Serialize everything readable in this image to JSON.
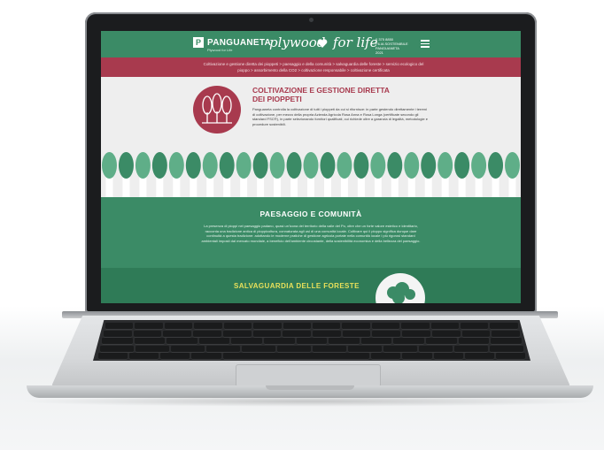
{
  "site": {
    "brand": "PANGUANETA",
    "brand_tagline": "Plywood for Life",
    "script_title_part1": "plywood",
    "script_title_part2": "for life",
    "contact_lines": [
      "0 375 8850",
      "FILIA SOSTENIBILE",
      "PANGUANETA",
      "2021"
    ],
    "breadcrumbs": "Coltivazione e gestione diretta dei pioppeti > paesaggio e della comunità > salvaguardia delle foreste > servizio ecologico del pioppo > assorbimento della CO2 > coltivazione responsabile > coltivazione certificata",
    "intro": {
      "title_line1": "COLTIVAZIONE E GESTIONE DIRETTA",
      "title_line2": "DEI PIOPPETI",
      "body": "Panguaneta controlla la coltivazione di tutti i pioppeti da cui si rifornisce: in parte gestendo direttamente i terreni di coltivazione, per mezzo della propria Azienda Agricola Rosa Anna e Rosa Longa (certificate secondo gli standard FSC®), in parte selezionando fornitori qualificati, cui richiede oltre a garanzia di legalità, metodologie e procedure sostenibili."
    },
    "section2": {
      "title": "PAESAGGIO E COMUNITÀ",
      "body": "La presenza di pioppi nel paesaggio padano, quasi un'icona del territorio della valle del Po, oltre che un forte valore estetico e identitario, racconta una tradizione antica di pioppicoltura, connaturata agli usi di una comunità locale. Coltivare qui il pioppo significa dunque dare continuità a questa tradizione: adottando le moderne pratiche di gestione agricola portate nella comunità locale i più rigorosi standard ambientali imposti dal mercato mondiale, a beneficio dell'ambiente circostante, della sostenibilità economica e della bellezza del paesaggio."
    },
    "section3": {
      "title": "SALVAGUARDIA DELLE FORESTE"
    }
  },
  "colors": {
    "green": "#3b8b66",
    "burgundy": "#a83a4e",
    "light_green_tree": "#5fae88",
    "yellow_heading": "#e8e05a"
  },
  "icons": [
    "logo-mark-icon",
    "heart-icon",
    "menu-icon",
    "poplar-trees-icon",
    "tree-row-icon",
    "forest-icon",
    "camera-icon"
  ]
}
